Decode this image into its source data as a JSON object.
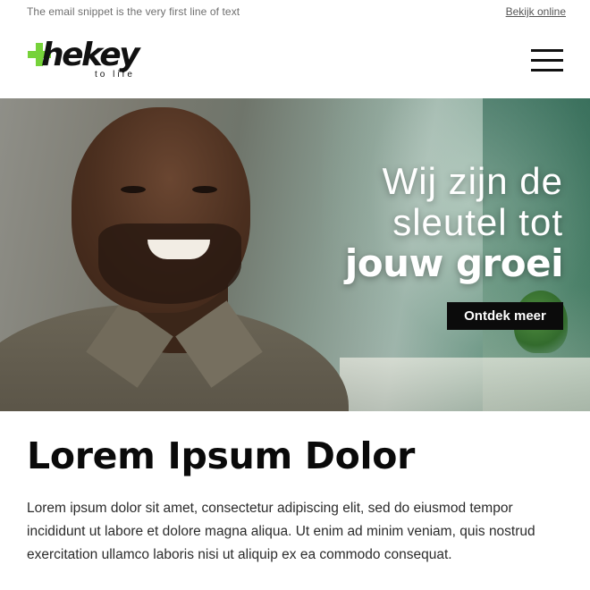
{
  "topbar": {
    "snippet": "The email snippet is the very first line of text",
    "view_online": "Bekijk online"
  },
  "header": {
    "logo_word": "hekey",
    "logo_tagline": "to life",
    "logo_accent_color": "#76d23a",
    "menu_icon": "hamburger-menu-icon"
  },
  "hero": {
    "line1": "Wij zijn de",
    "line2": "sleutel tot",
    "line3": "jouw groei",
    "cta_label": "Ontdek meer",
    "cta_color": "#0b0b0b"
  },
  "content": {
    "title": "Lorem Ipsum Dolor",
    "body": "Lorem ipsum dolor sit amet, consectetur adipiscing elit, sed do eiusmod tempor incididunt ut labore et dolore magna aliqua. Ut enim ad minim veniam, quis nostrud exercitation ullamco laboris nisi ut aliquip ex ea commodo consequat."
  }
}
